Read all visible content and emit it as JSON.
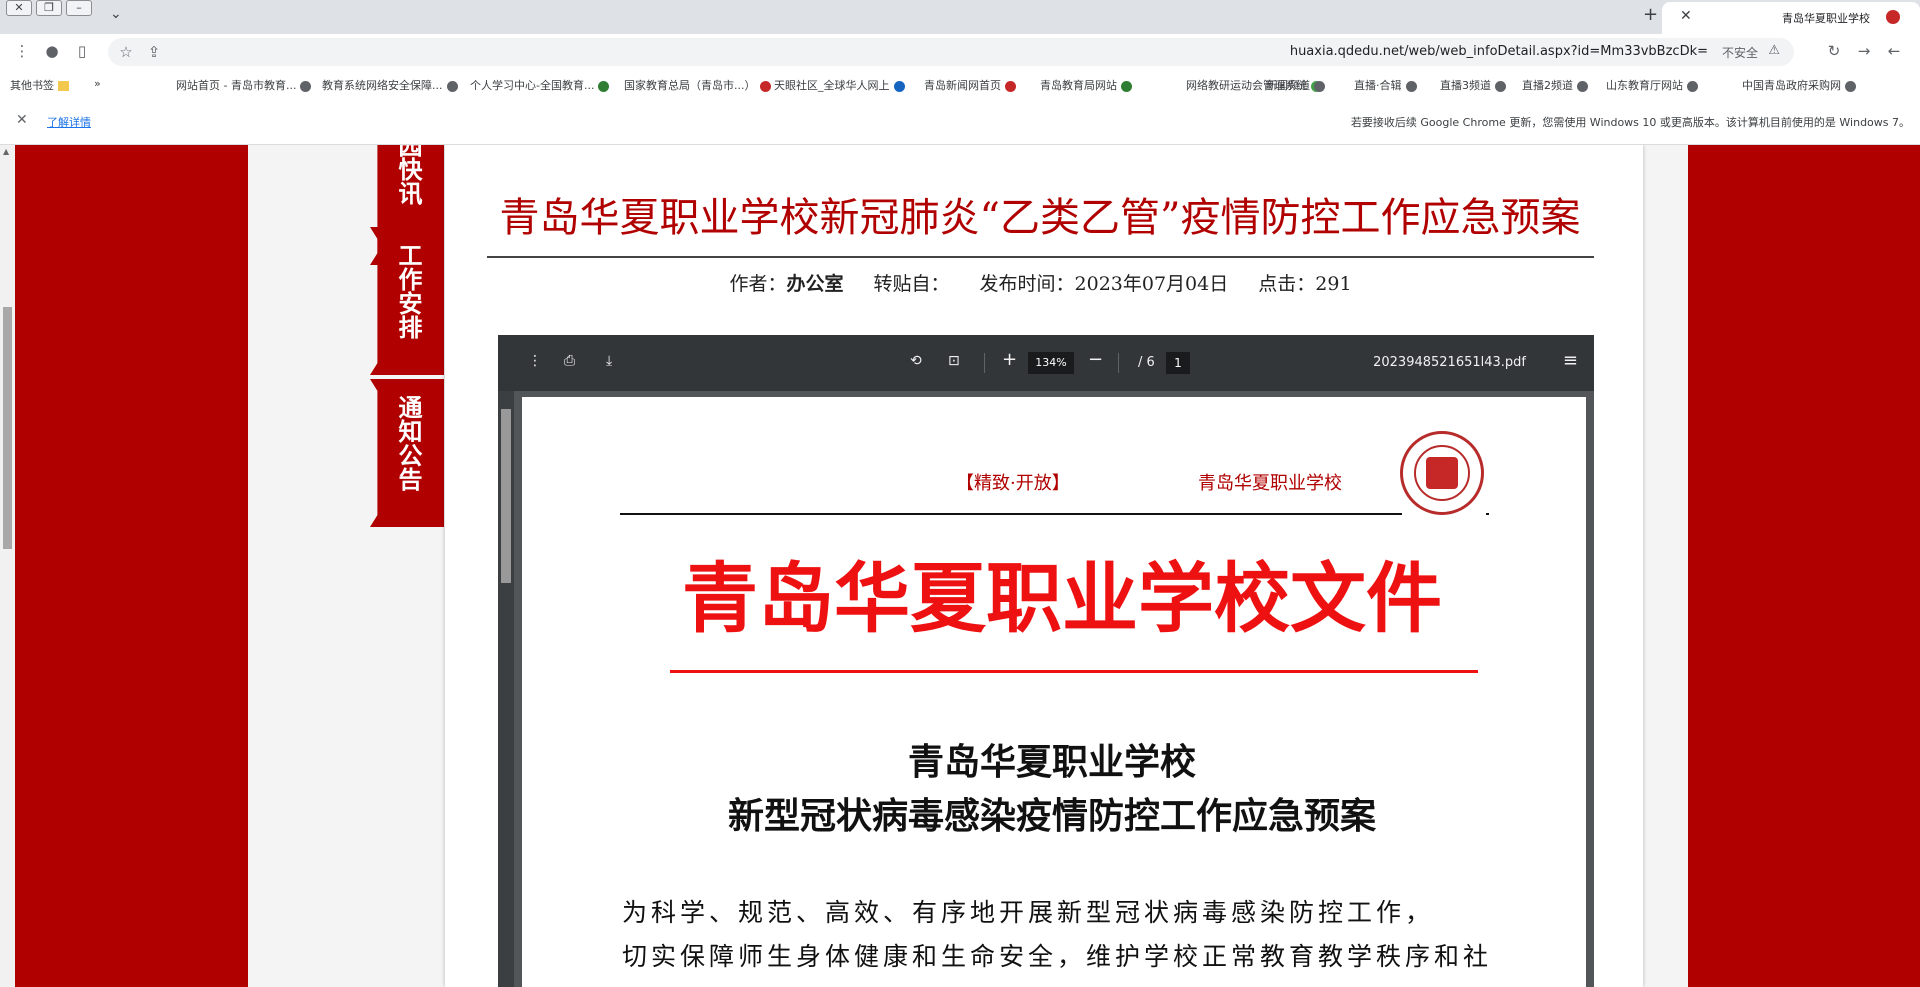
{
  "browser": {
    "tab_title": "青岛华夏职业学校",
    "url": "huaxia.qdedu.net/web/web_infoDetail.aspx?id=Mm33vbBzcDk=",
    "security_label": "不安全",
    "bookmarks": [
      "中国青岛政府采购网",
      "山东教育厅网站",
      "直播2频道",
      "直播3频道",
      "直播·合辑",
      "新闻频道",
      "网络教研运动会管理系统",
      "青岛教育局网站",
      "青岛新闻网首页",
      "天眼社区_全球华人网上",
      "国家教育总局（青岛市...）",
      "个人学习中心-全国教育...",
      "教育系统网络安全保障...",
      "网站首页 - 青岛市教育..."
    ],
    "bookmarks_more": "»",
    "other_bookmarks": "其他书签",
    "infobar_text": "若要接收后续 Google Chrome 更新，您需使用 Windows 10 或更高版本。该计算机目前使用的是 Windows 7。",
    "infobar_link": "了解详情"
  },
  "sidebar_tabs": [
    "通知公告",
    "工作安排",
    "园快讯"
  ],
  "article": {
    "title": "青岛华夏职业学校新冠肺炎“乙类乙管”疫情防控工作应急预案",
    "meta_author_label": "作者：",
    "meta_author": "办公室",
    "meta_from_label": "转贴自：",
    "meta_time_label": "发布时间：",
    "meta_time": "2023年07月04日",
    "meta_clicks_label": "点击：",
    "meta_clicks": "291"
  },
  "pdf": {
    "filename": "2023948521651l43.pdf",
    "page_current": "1",
    "page_total": "/ 6",
    "zoom": "134%",
    "letterhead_school": "青岛华夏职业学校",
    "letterhead_motto": "【精致·开放】",
    "doc_title": "青岛华夏职业学校文件",
    "subtitle_line1": "青岛华夏职业学校",
    "subtitle_line2": "新型冠状病毒感染疫情防控工作应急预案",
    "body_line1": "为科学、规范、高效、有序地开展新型冠状病毒感染防控工作，",
    "body_line2": "切实保障师生身体健康和生命安全，维护学校正常教育教学秩序和社"
  }
}
